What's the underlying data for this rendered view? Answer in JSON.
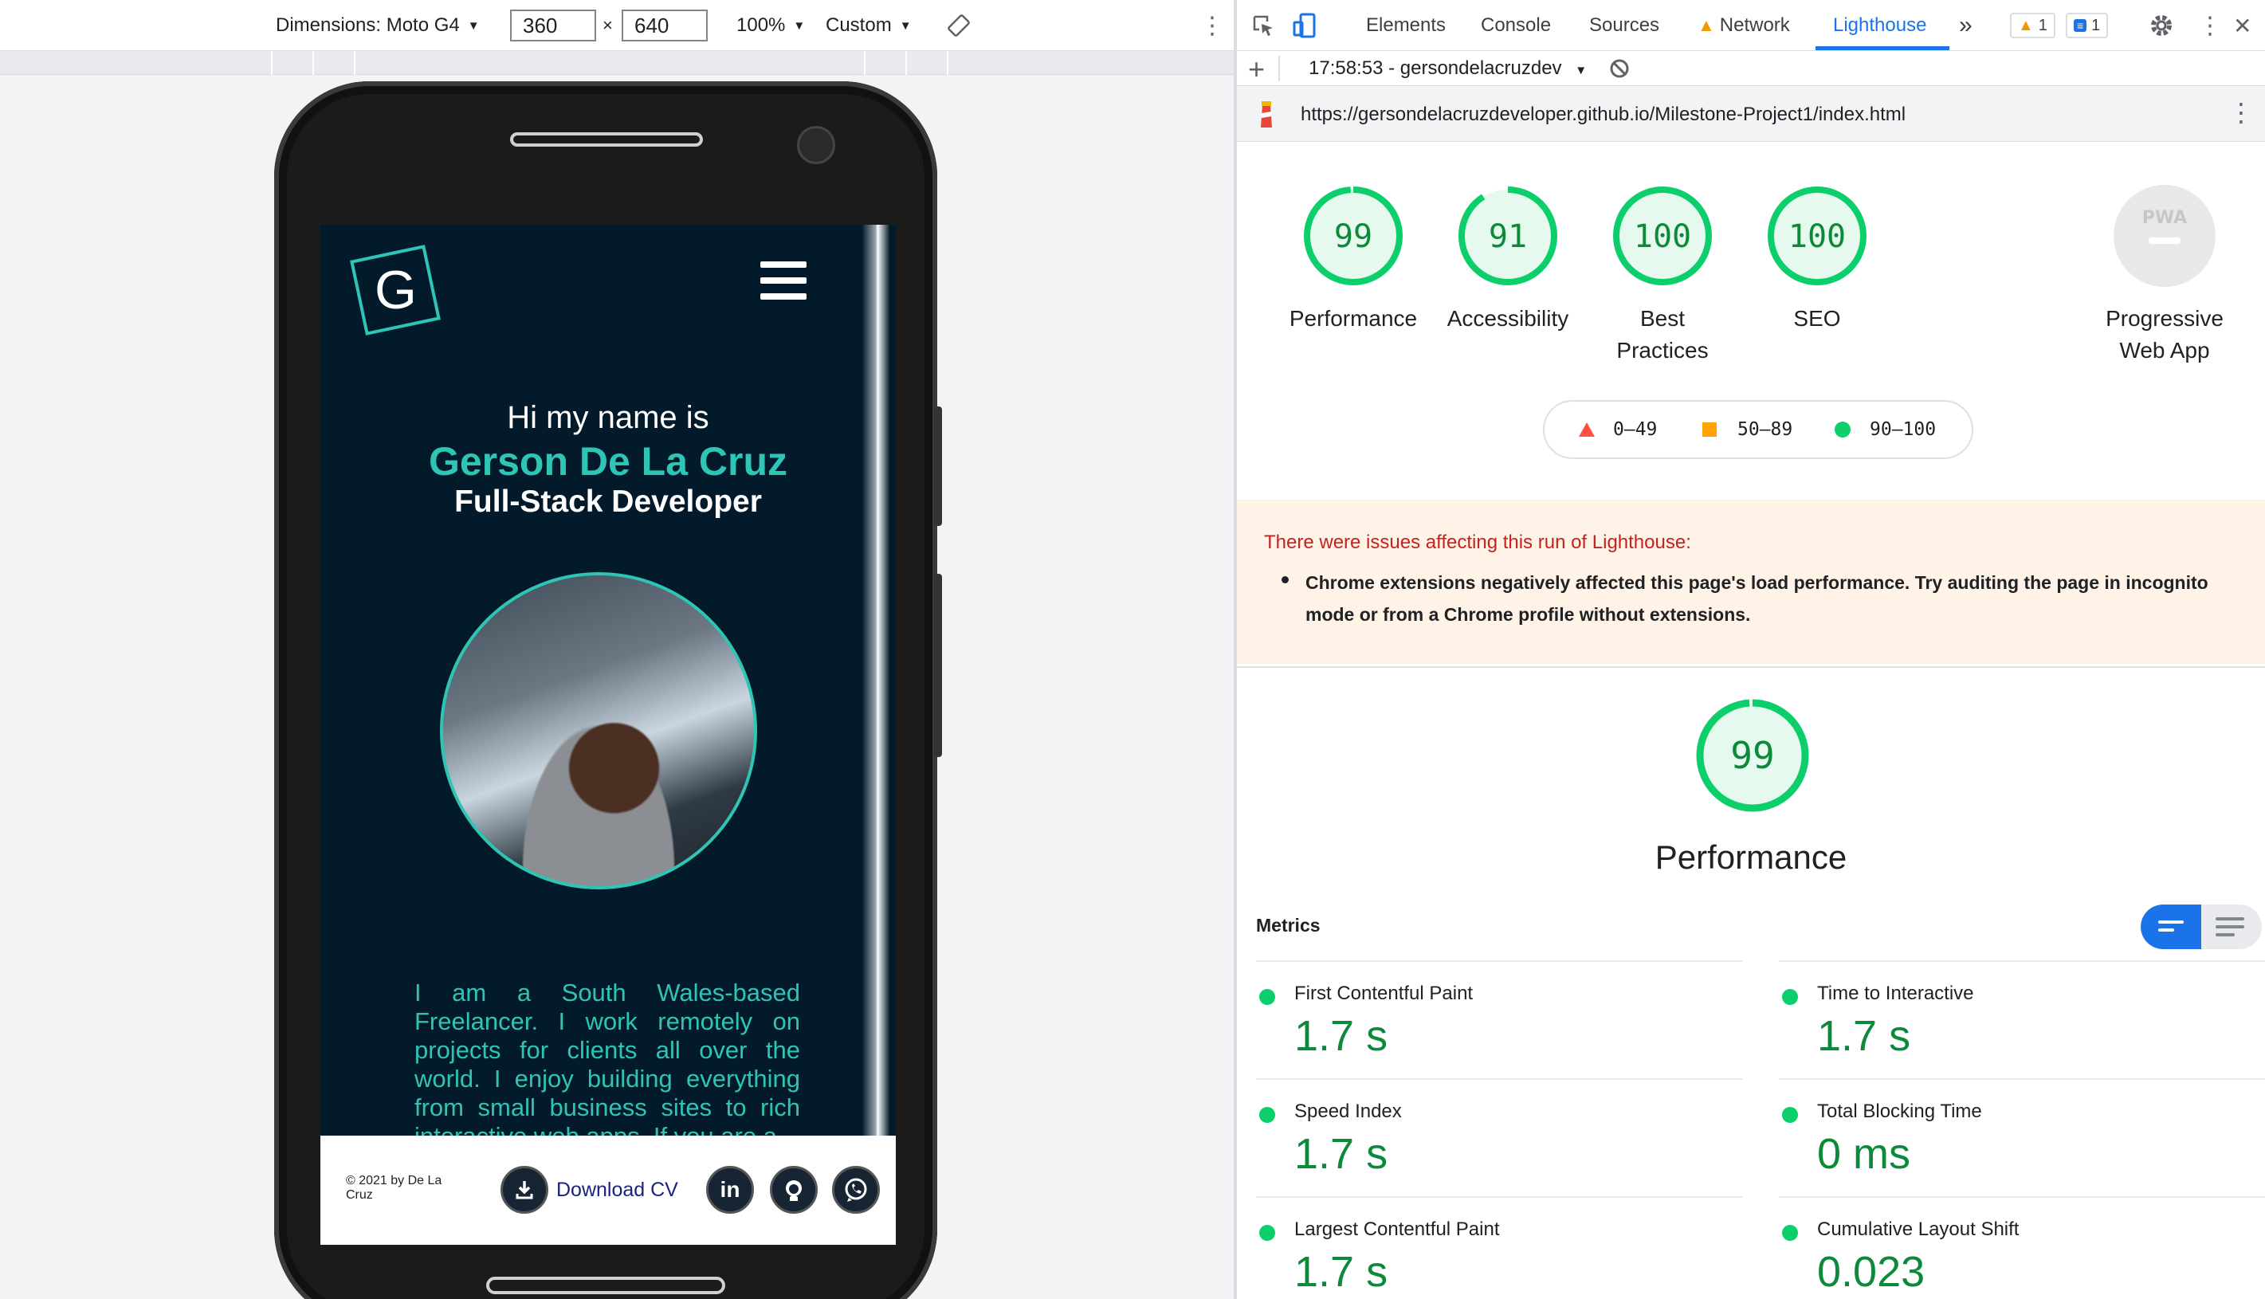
{
  "device_toolbar": {
    "dimensions_label": "Dimensions: Moto G4",
    "width": "360",
    "height": "640",
    "times": "×",
    "zoom": "100%",
    "throttle": "Custom",
    "more": "⋮"
  },
  "site": {
    "logo_letter": "G",
    "hi": "Hi my name is",
    "name": "Gerson De La Cruz",
    "role": "Full-Stack Developer",
    "bio": "I am a South Wales-based Freelancer. I work remotely on projects for clients all over the world. I enjoy building everything from small business sites to rich interactive web apps. If you are a",
    "copyright": "© 2021 by De La Cruz",
    "download_cv": "Download CV",
    "social": [
      "in",
      "github-icon",
      "whatsapp-icon"
    ]
  },
  "devtools": {
    "tabs": [
      "Elements",
      "Console",
      "Sources",
      "Network",
      "Lighthouse"
    ],
    "more_tabs": "»",
    "warning_count": "1",
    "issue_count": "1",
    "report_time": "17:58:53 - gersondelacruzdev",
    "url": "https://gersondelacruzdeveloper.github.io/Milestone-Project1/index.html",
    "more": "⋮",
    "close": "✕"
  },
  "categories": [
    {
      "score": 99,
      "label_l1": "Performance",
      "label_l2": ""
    },
    {
      "score": 91,
      "label_l1": "Accessibility",
      "label_l2": ""
    },
    {
      "score": 100,
      "label_l1": "Best",
      "label_l2": "Practices"
    },
    {
      "score": 100,
      "label_l1": "SEO",
      "label_l2": ""
    }
  ],
  "pwa": {
    "badge": "PWA",
    "label_l1": "Progressive",
    "label_l2": "Web App"
  },
  "legend": {
    "fail": "0–49",
    "average": "50–89",
    "pass": "90–100"
  },
  "warning": {
    "title": "There were issues affecting this run of Lighthouse:",
    "item": "Chrome extensions negatively affected this page's load performance. Try auditing the page in incognito mode or from a Chrome profile without extensions."
  },
  "performance": {
    "score": 99,
    "label": "Performance"
  },
  "metrics_title": "Metrics",
  "metrics": [
    {
      "name": "First Contentful Paint",
      "value": "1.7 s"
    },
    {
      "name": "Time to Interactive",
      "value": "1.7 s"
    },
    {
      "name": "Speed Index",
      "value": "1.7 s"
    },
    {
      "name": "Total Blocking Time",
      "value": "0 ms"
    },
    {
      "name": "Largest Contentful Paint",
      "value": "1.7 s"
    },
    {
      "name": "Cumulative Layout Shift",
      "value": "0.023"
    }
  ],
  "colors": {
    "pass": "#0cce6b",
    "average": "#ffa400",
    "fail": "#ff4e42",
    "accent": "#1a73e8",
    "site_bg": "#031a2b",
    "site_accent": "#2ec4b6"
  }
}
